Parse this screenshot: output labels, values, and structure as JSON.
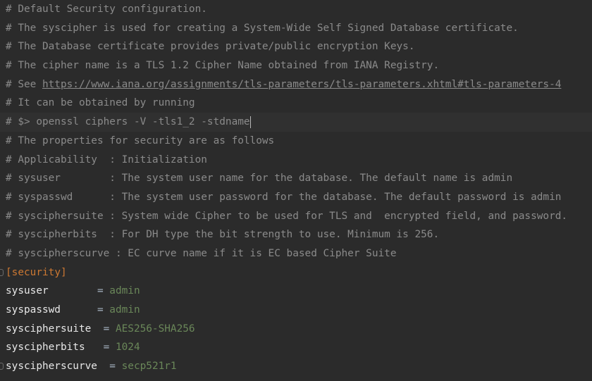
{
  "editor": {
    "comments": [
      "# Default Security configuration.",
      "# The syscipher is used for creating a System-Wide Self Signed Database certificate.",
      "# The Database certificate provides private/public encryption Keys.",
      "# The cipher name is a TLS 1.2 Cipher Name obtained from IANA Registry."
    ],
    "see_prefix": "# See ",
    "see_link": "https://www.iana.org/assignments/tls-parameters/tls-parameters.xhtml#tls-parameters-4",
    "comments2": [
      "# It can be obtained by running",
      "# $> openssl ciphers -V -tls1_2 -stdname",
      "# The properties for security are as follows",
      "# Applicability  : Initialization",
      "# sysuser        : The system user name for the database. The default name is admin",
      "# syspasswd      : The system user password for the database. The default password is admin",
      "# sysciphersuite : System wide Cipher to be used for TLS and  encrypted field, and password.",
      "# syscipherbits  : For DH type the bit strength to use. Minimum is 256.",
      "# syscipherscurve : EC curve name if it is EC based Cipher Suite"
    ],
    "section_open": "[",
    "section_name": "security",
    "section_close": "]",
    "entries": [
      {
        "key": "sysuser        ",
        "eq": "= ",
        "value": "admin"
      },
      {
        "key": "syspasswd      ",
        "eq": "= ",
        "value": "admin"
      },
      {
        "key": "sysciphersuite  ",
        "eq": "= ",
        "value": "AES256-SHA256"
      },
      {
        "key": "syscipherbits   ",
        "eq": "= ",
        "value": "1024"
      },
      {
        "key": "syscipherscurve  ",
        "eq": "= ",
        "value": "secp521r1"
      }
    ]
  },
  "colors": {
    "background": "#2b2b2b",
    "current_line": "#323232",
    "comment": "#a5a5a5",
    "section": "#cc7832",
    "key": "#e8e8e8",
    "value": "#6a8759"
  }
}
